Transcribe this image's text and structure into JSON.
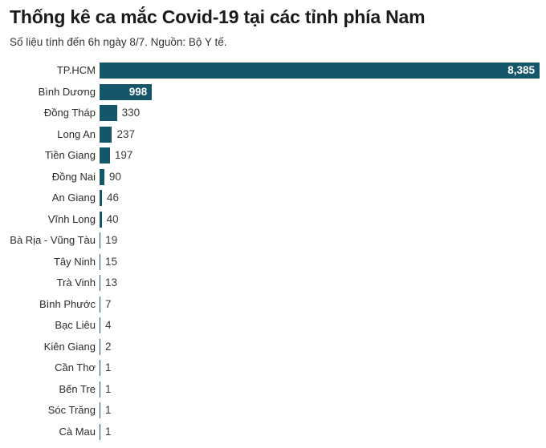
{
  "header": {
    "title": "Thống kê ca mắc Covid-19 tại các tỉnh phía Nam",
    "subtitle": "Số liệu tính đến 6h ngày 8/7. Nguồn: Bộ Y tế."
  },
  "style": {
    "bar_color": "#15566b",
    "label_color": "#2b2b2b",
    "value_color_inside": "#ffffff",
    "value_color_outside": "#3a3a3a",
    "background": "#ffffff"
  },
  "chart_data": {
    "type": "bar",
    "orientation": "horizontal",
    "title": "Thống kê ca mắc Covid-19 tại các tỉnh phía Nam",
    "subtitle": "Số liệu tính đến 6h ngày 8/7. Nguồn: Bộ Y tế.",
    "xlabel": "",
    "ylabel": "",
    "xlim": [
      0,
      8385
    ],
    "grid": false,
    "legend": false,
    "categories": [
      "TP.HCM",
      "Bình Dương",
      "Đồng Tháp",
      "Long An",
      "Tiền Giang",
      "Đồng Nai",
      "An Giang",
      "Vĩnh Long",
      "Bà Rịa - Vũng Tàu",
      "Tây Ninh",
      "Trà Vinh",
      "Bình Phước",
      "Bạc Liêu",
      "Kiên Giang",
      "Cần Thơ",
      "Bến Tre",
      "Sóc Trăng",
      "Cà Mau"
    ],
    "values": [
      8385,
      998,
      330,
      237,
      197,
      90,
      46,
      40,
      19,
      15,
      13,
      7,
      4,
      2,
      1,
      1,
      1,
      1
    ],
    "value_labels": [
      "8,385",
      "998",
      "330",
      "237",
      "197",
      "90",
      "46",
      "40",
      "19",
      "15",
      "13",
      "7",
      "4",
      "2",
      "1",
      "1",
      "1",
      "1"
    ],
    "label_placement": [
      "inside",
      "inside",
      "outside",
      "outside",
      "outside",
      "outside",
      "outside",
      "outside",
      "outside",
      "outside",
      "outside",
      "outside",
      "outside",
      "outside",
      "outside",
      "outside",
      "outside",
      "outside"
    ]
  }
}
